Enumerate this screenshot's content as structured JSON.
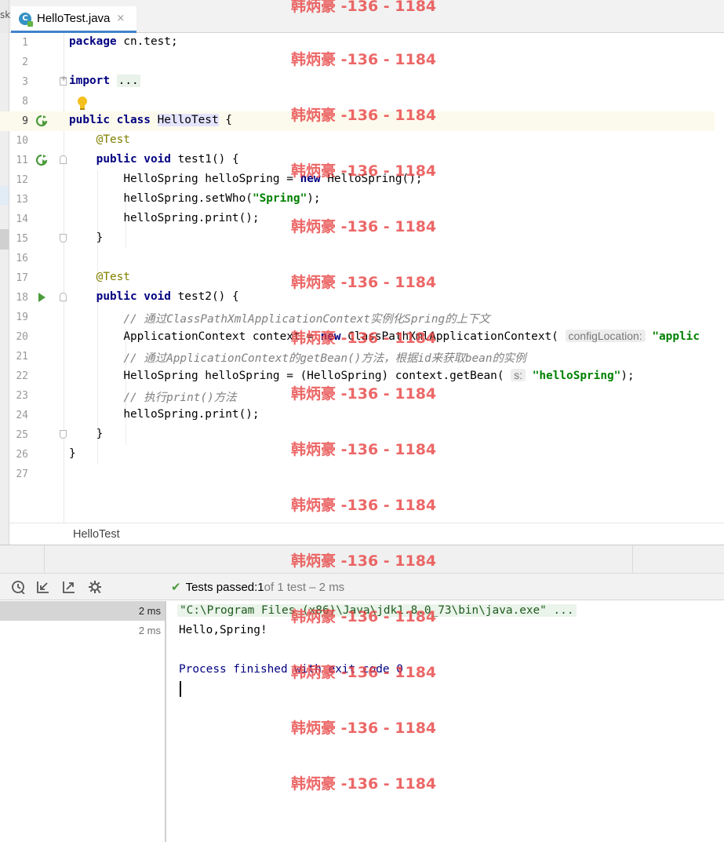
{
  "tab": {
    "icon_letter": "C",
    "label": "HelloTest.java",
    "close": "×"
  },
  "left_strip_text": "sk",
  "editor": {
    "lines": [
      {
        "n": "1"
      },
      {
        "n": "2"
      },
      {
        "n": "3"
      },
      {
        "n": "8"
      },
      {
        "n": "9"
      },
      {
        "n": "10"
      },
      {
        "n": "11"
      },
      {
        "n": "12"
      },
      {
        "n": "13"
      },
      {
        "n": "14"
      },
      {
        "n": "15"
      },
      {
        "n": "16"
      },
      {
        "n": "17"
      },
      {
        "n": "18"
      },
      {
        "n": "19"
      },
      {
        "n": "20"
      },
      {
        "n": "21"
      },
      {
        "n": "22"
      },
      {
        "n": "23"
      },
      {
        "n": "24"
      },
      {
        "n": "25"
      },
      {
        "n": "26"
      },
      {
        "n": "27"
      }
    ],
    "code": {
      "l1_kw": "package",
      "l1_rest": " cn.test;",
      "l3_kw": "import",
      "l3_fold": "...",
      "l9_kw": "public class",
      "l9_name": "HelloTest",
      "l9_rest": " {",
      "l10_an": "@Test",
      "l11_kw": "public void",
      "l11_rest": " test1() {",
      "l12_a": "HelloSpring helloSpring = ",
      "l12_kw": "new",
      "l12_b": " HelloSpring();",
      "l13_a": "helloSpring.setWho(",
      "l13_str": "\"Spring\"",
      "l13_b": ");",
      "l14": "helloSpring.print();",
      "l15": "}",
      "l17_an": "@Test",
      "l18_kw": "public void",
      "l18_rest": " test2() {",
      "l19_cm": "// 通过ClassPathXmlApplicationContext实例化Spring的上下文",
      "l20_a": "ApplicationContext context = ",
      "l20_kw": "new",
      "l20_b": " ClassPathXmlApplicationContext( ",
      "l20_hint": "configLocation:",
      "l20_str": " \"applic",
      "l21_cm": "// 通过ApplicationContext的getBean()方法，根据id来获取bean的实例",
      "l22_a": "HelloSpring helloSpring = (HelloSpring) context.getBean( ",
      "l22_hint": "s:",
      "l22_str": " \"helloSpring\"",
      "l22_b": ");",
      "l23_cm": "// 执行print()方法",
      "l24": "helloSpring.print();",
      "l25": "}",
      "l26": "}"
    }
  },
  "breadcrumb": "HelloTest",
  "run": {
    "status_check": "✔",
    "status_label": "Tests passed: ",
    "status_count": "1",
    "status_rest": " of 1 test – 2 ms",
    "tree_rows": [
      {
        "time": "2 ms"
      },
      {
        "time": "2 ms"
      }
    ],
    "console": {
      "cmd": "\"C:\\Program Files (x86)\\Java\\jdk1.8.0_73\\bin\\java.exe\" ...",
      "out": "Hello,Spring!",
      "exit": "Process finished with exit code 0"
    }
  },
  "watermark": "韩炳豪 -136 - 1184",
  "colors": {
    "keyword": "#000080",
    "annotation": "#808000",
    "string": "#008000",
    "comment": "#808080",
    "run_icon": "#4a9c3b",
    "watermark": "#e84646"
  }
}
